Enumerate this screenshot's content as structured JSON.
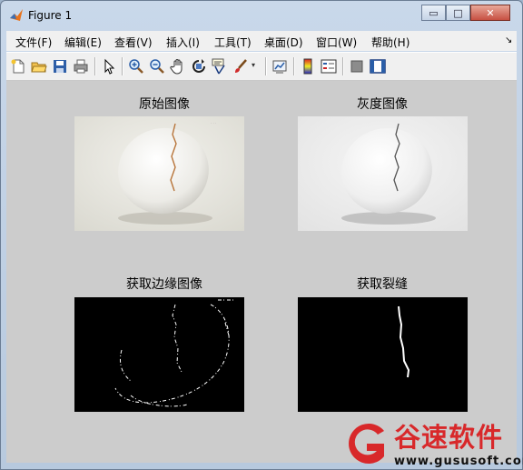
{
  "window": {
    "title": "Figure 1",
    "minimize_glyph": "▭",
    "maximize_glyph": "□",
    "close_glyph": "✕"
  },
  "menu": [
    "文件(F)",
    "编辑(E)",
    "查看(V)",
    "插入(I)",
    "工具(T)",
    "桌面(D)",
    "窗口(W)",
    "帮助(H)"
  ],
  "menu_corner_glyph": "↘",
  "toolbar": [
    "new-file-icon",
    "open-folder-icon",
    "save-icon",
    "print-icon",
    "pointer-icon",
    "zoom-in-icon",
    "zoom-out-icon",
    "pan-hand-icon",
    "rotate-3d-icon",
    "data-cursor-icon",
    "brush-icon",
    "dropdown-arrow-icon",
    "link-plot-icon",
    "colorbar-icon",
    "legend-icon",
    "hide-plot-tools-icon",
    "show-plot-tools-icon"
  ],
  "subplots": [
    {
      "title": "原始图像"
    },
    {
      "title": "灰度图像"
    },
    {
      "title": "获取边缘图像"
    },
    {
      "title": "获取裂缝"
    }
  ],
  "watermark": {
    "brand": "谷速软件",
    "url": "www.gususoft.com"
  },
  "colors": {
    "canvas": "#cccccc",
    "brand_red": "#d8282a",
    "titlebar": "#c9d8ea"
  }
}
